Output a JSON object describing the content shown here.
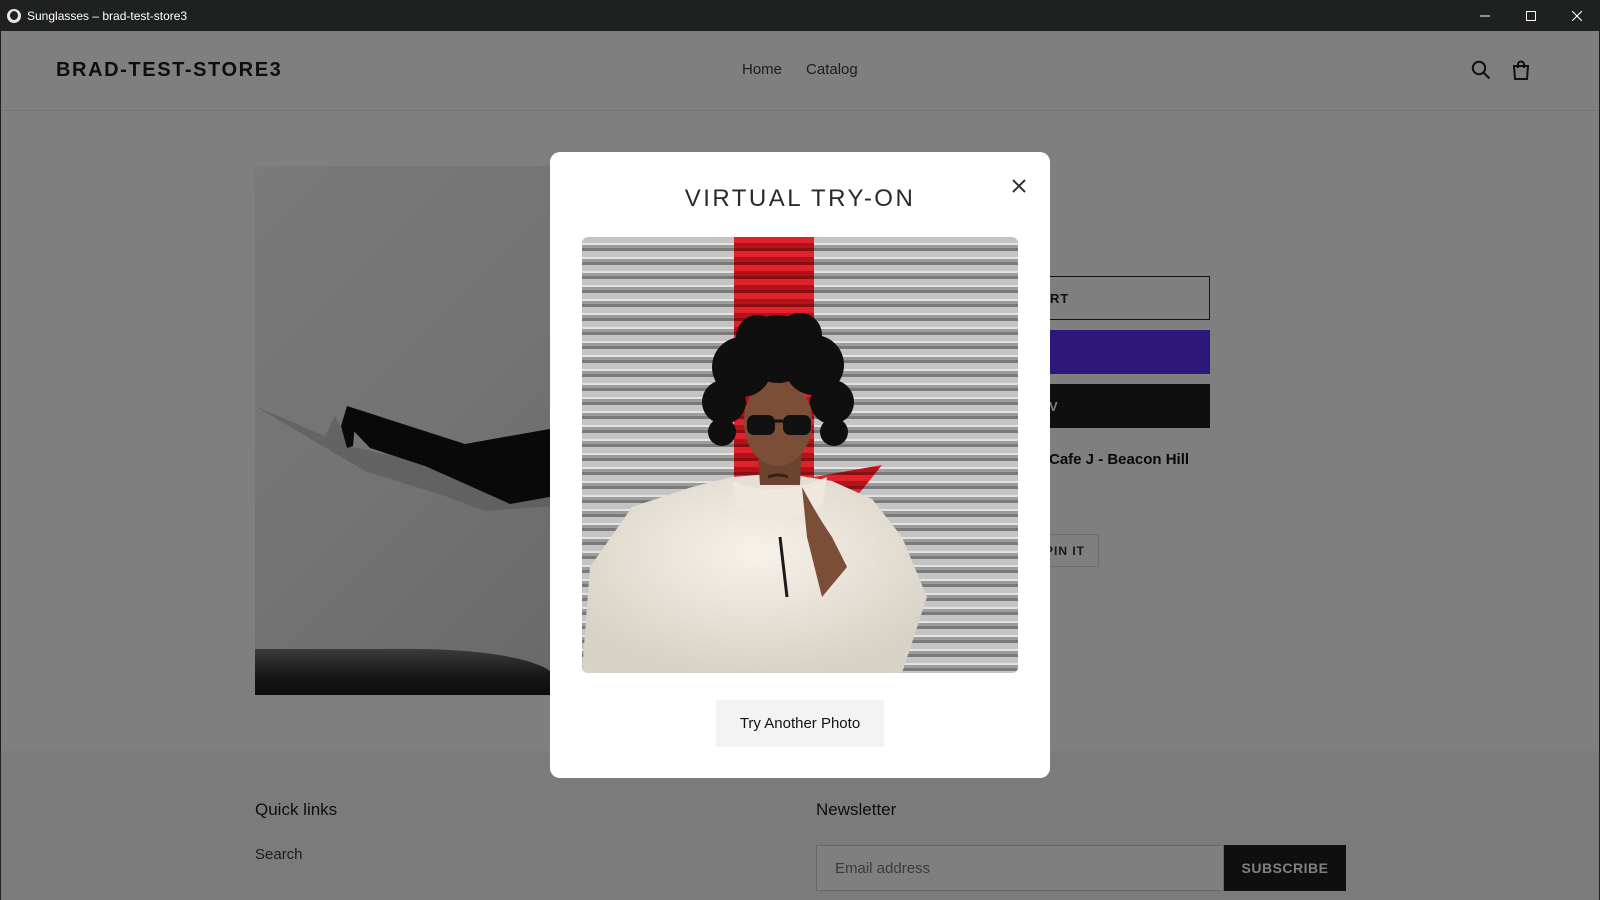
{
  "window": {
    "title": "Sunglasses – brad-test-store3"
  },
  "header": {
    "logo": "BRAD-TEST-STORE3",
    "nav": [
      {
        "label": "Home"
      },
      {
        "label": "Catalog"
      }
    ],
    "icons": [
      "search-icon",
      "cart-icon"
    ]
  },
  "product": {
    "add_to_cart_partial": "RT",
    "buy_now_partial": "V",
    "pickup_location": "Cafe J - Beacon Hill",
    "pin_partial": "PIN IT"
  },
  "footer": {
    "quick_links_heading": "Quick links",
    "quick_links": [
      {
        "label": "Search"
      }
    ],
    "newsletter_heading": "Newsletter",
    "email_placeholder": "Email address",
    "subscribe_label": "SUBSCRIBE"
  },
  "modal": {
    "title": "VIRTUAL TRY-ON",
    "try_another_label": "Try Another Photo"
  },
  "colors": {
    "shop_pay": "#5a31f4",
    "button_dark": "#1f1f1f",
    "overlay": "rgba(0,0,0,0.5)"
  }
}
